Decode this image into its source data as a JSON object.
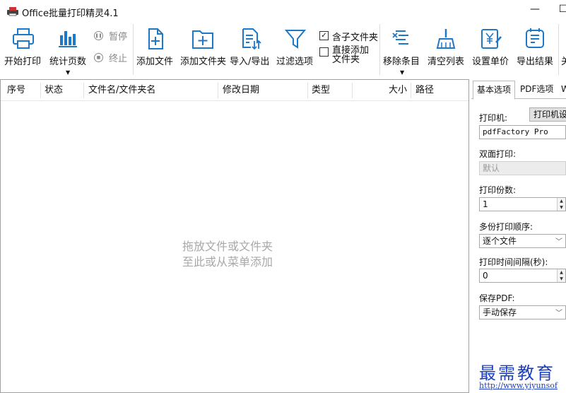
{
  "window": {
    "title": "Office批量打印精灵4.1",
    "minimize": "—",
    "maximize": "☐"
  },
  "toolbar": {
    "start_print": "开始打印",
    "count_pages": "统计页数",
    "pause": "暂停",
    "stop": "终止",
    "add_file": "添加文件",
    "add_folder": "添加文件夹",
    "import_export": "导入/导出",
    "filter": "过滤选项",
    "include_subfolders": "含子文件夹",
    "include_subfolders_checked": true,
    "add_folder_direct": "直接添加文件夹",
    "add_folder_direct_checked": false,
    "remove_items": "移除条目",
    "clear_list": "清空列表",
    "set_price": "设置单价",
    "export_results": "导出结果",
    "more": "关"
  },
  "list": {
    "columns": [
      "序号",
      "状态",
      "文件名/文件夹名",
      "修改日期",
      "类型",
      "大小",
      "路径"
    ],
    "empty_hint_line1": "拖放文件或文件夹",
    "empty_hint_line2": "至此或从菜单添加"
  },
  "panel": {
    "tabs": [
      "基本选项",
      "PDF选项",
      "W"
    ],
    "active_tab": "基本选项",
    "printer_label": "打印机:",
    "printer_setup_button": "打印机设",
    "printer_value": "pdfFactory Pro",
    "duplex_label": "双面打印:",
    "duplex_value": "默认",
    "copies_label": "打印份数:",
    "copies_value": "1",
    "order_label": "多份打印顺序:",
    "order_value": "逐个文件",
    "interval_label": "打印时间间隔(秒):",
    "interval_value": "0",
    "save_pdf_label": "保存PDF:",
    "save_pdf_value": "手动保存"
  },
  "watermark": {
    "text": "最需教育",
    "url": "http://www.yiyunsof"
  },
  "colors": {
    "accent": "#1e78c8",
    "border": "#a0a0a0",
    "hint": "#a8a8a8",
    "watermark": "#1c3fbf"
  }
}
